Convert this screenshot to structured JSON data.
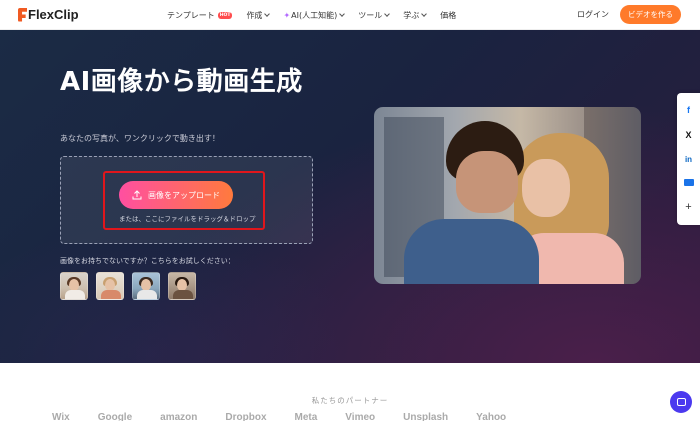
{
  "header": {
    "logo_text": "FlexClip",
    "nav": [
      {
        "label": "テンプレート",
        "badge": "HOT"
      },
      {
        "label": "作成"
      },
      {
        "label": "AI(人工知能)"
      },
      {
        "label": "ツール"
      },
      {
        "label": "学ぶ"
      },
      {
        "label": "価格"
      }
    ],
    "login": "ログイン",
    "cta": "ビデオを作る"
  },
  "hero": {
    "title": "AI画像から動画生成",
    "subtitle": "あなたの写真が、ワンクリックで動き出す！",
    "upload_button": "画像をアップロード",
    "drop_hint": "または、ここにファイルをドラッグ＆ドロップ",
    "try_text": "画像をお持ちでないですか？こちらをお試しください：",
    "photo_alt": "kissing couple"
  },
  "share": [
    "f",
    "X",
    "in",
    "",
    "+"
  ],
  "partners": {
    "title": "私たちのパートナー",
    "logos": [
      "Wix",
      "Google",
      "amazon",
      "Dropbox",
      "Meta",
      "Vimeo",
      "Unsplash",
      "Yahoo"
    ]
  },
  "colors": {
    "accent": "#ff7a2a",
    "upload_gradient_start": "#ff4fa1",
    "upload_gradient_end": "#ff7a3d",
    "highlight": "#e0161c",
    "chat": "#4b39ef"
  }
}
